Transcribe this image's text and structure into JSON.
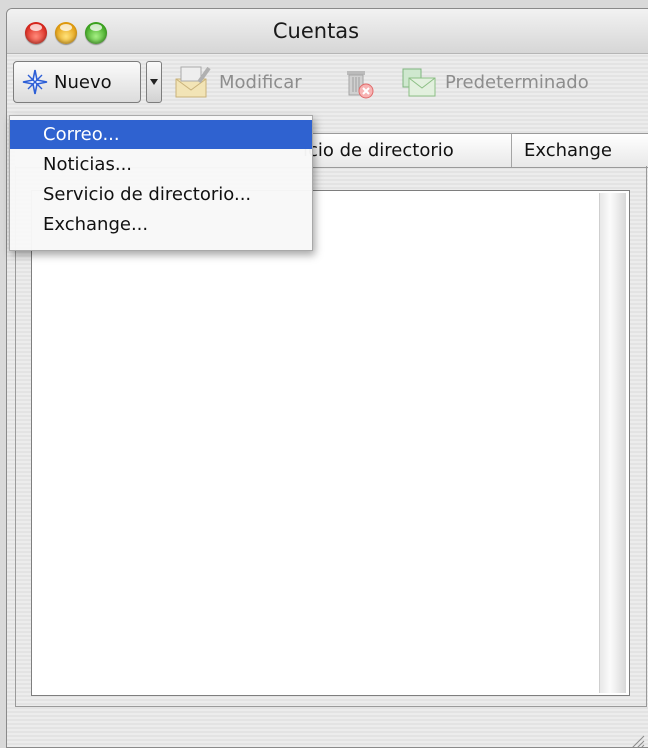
{
  "window": {
    "title": "Cuentas"
  },
  "toolbar": {
    "new_label": "Nuevo",
    "edit_label": "Modificar",
    "default_label": "Predeterminado"
  },
  "tabs": {
    "partial_label": "icio de directorio",
    "exchange_label": "Exchange"
  },
  "menu": {
    "items": [
      {
        "label": "Correo..."
      },
      {
        "label": "Noticias..."
      },
      {
        "label": "Servicio de directorio..."
      },
      {
        "label": "Exchange..."
      }
    ]
  },
  "colors": {
    "selection": "#2f62d0",
    "close": "#d8251b",
    "minimize": "#e19a0c",
    "zoom": "#3aa31e"
  }
}
